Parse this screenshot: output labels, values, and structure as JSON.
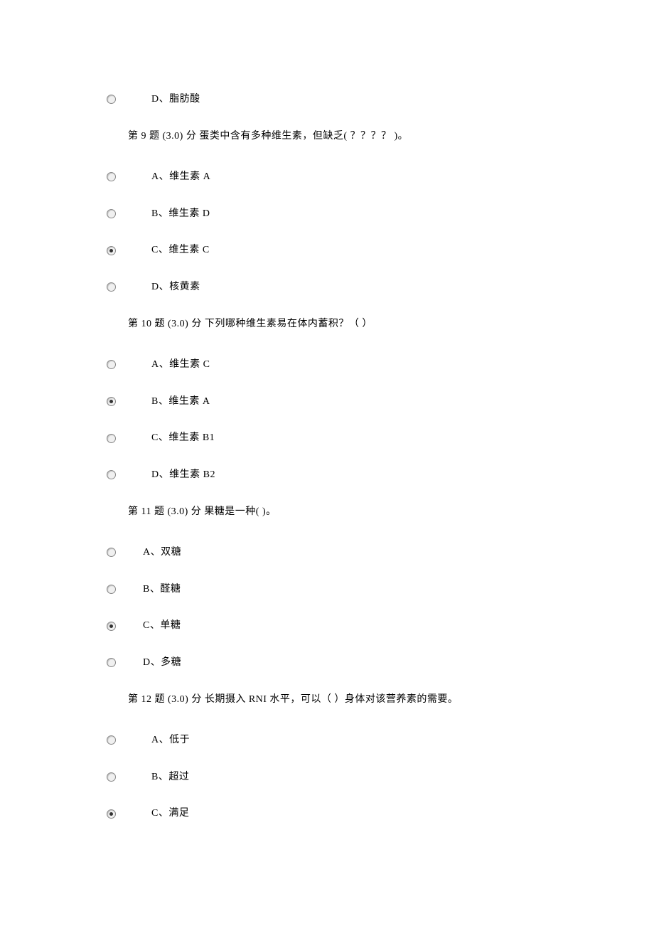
{
  "orphan_option": {
    "label": "D、脂肪酸",
    "selected": false
  },
  "questions": [
    {
      "prompt": "第 9 题 (3.0) 分 蛋类中含有多种维生素，但缺乏( ？？？？ )。",
      "options": [
        {
          "label": "A、维生素 A",
          "selected": false
        },
        {
          "label": "B、维生素 D",
          "selected": false
        },
        {
          "label": "C、维生素 C",
          "selected": true
        },
        {
          "label": "D、核黄素",
          "selected": false
        }
      ]
    },
    {
      "prompt": "第 10 题 (3.0) 分 下列哪种维生素易在体内蓄积？（ ）",
      "options": [
        {
          "label": "A、维生素 C",
          "selected": false
        },
        {
          "label": "B、维生素 A",
          "selected": true
        },
        {
          "label": "C、维生素 B1",
          "selected": false
        },
        {
          "label": "D、维生素 B2",
          "selected": false
        }
      ]
    },
    {
      "prompt": "第 11 题 (3.0) 分 果糖是一种( )。",
      "narrow": true,
      "options": [
        {
          "label": "A、双糖",
          "selected": false
        },
        {
          "label": "B、醛糖",
          "selected": false
        },
        {
          "label": "C、单糖",
          "selected": true
        },
        {
          "label": "D、多糖",
          "selected": false
        }
      ]
    },
    {
      "prompt": "第 12 题 (3.0) 分 长期摄入 RNI 水平，可以（ ）身体对该营养素的需要。",
      "options": [
        {
          "label": "A、低于",
          "selected": false
        },
        {
          "label": "B、超过",
          "selected": false
        },
        {
          "label": "C、满足",
          "selected": true
        }
      ]
    }
  ]
}
